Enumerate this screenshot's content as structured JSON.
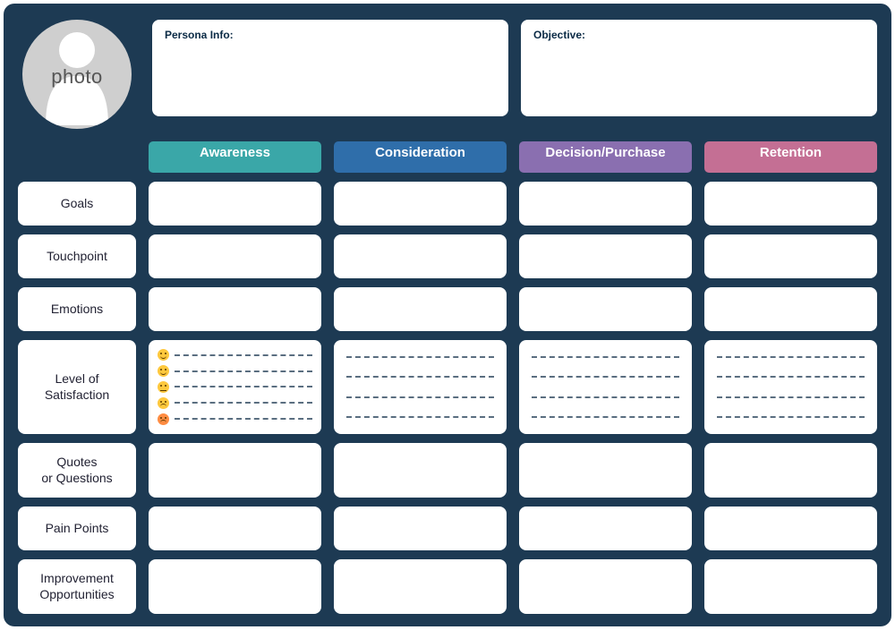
{
  "photo_label": "photo",
  "persona_info_label": "Persona Info:",
  "objective_label": "Objective:",
  "stages": [
    {
      "name": "Awareness",
      "color": "#3aa7a8"
    },
    {
      "name": "Consideration",
      "color": "#2f6eaa"
    },
    {
      "name": "Decision/Purchase",
      "color": "#8a6fb0"
    },
    {
      "name": "Retention",
      "color": "#c46f94"
    }
  ],
  "rows": [
    {
      "label": "Goals",
      "height": "row-short"
    },
    {
      "label": "Touchpoint",
      "height": "row-short"
    },
    {
      "label": "Emotions",
      "height": "row-short"
    },
    {
      "label": "Level of\nSatisfaction",
      "height": "row-tall",
      "type": "satisfaction"
    },
    {
      "label": "Quotes\nor Questions",
      "height": "row-med"
    },
    {
      "label": "Pain Points",
      "height": "row-short"
    },
    {
      "label": "Improvement\nOpportunities",
      "height": "row-med"
    }
  ],
  "satisfaction_levels": 5,
  "satisfaction_dash_lines": 4
}
